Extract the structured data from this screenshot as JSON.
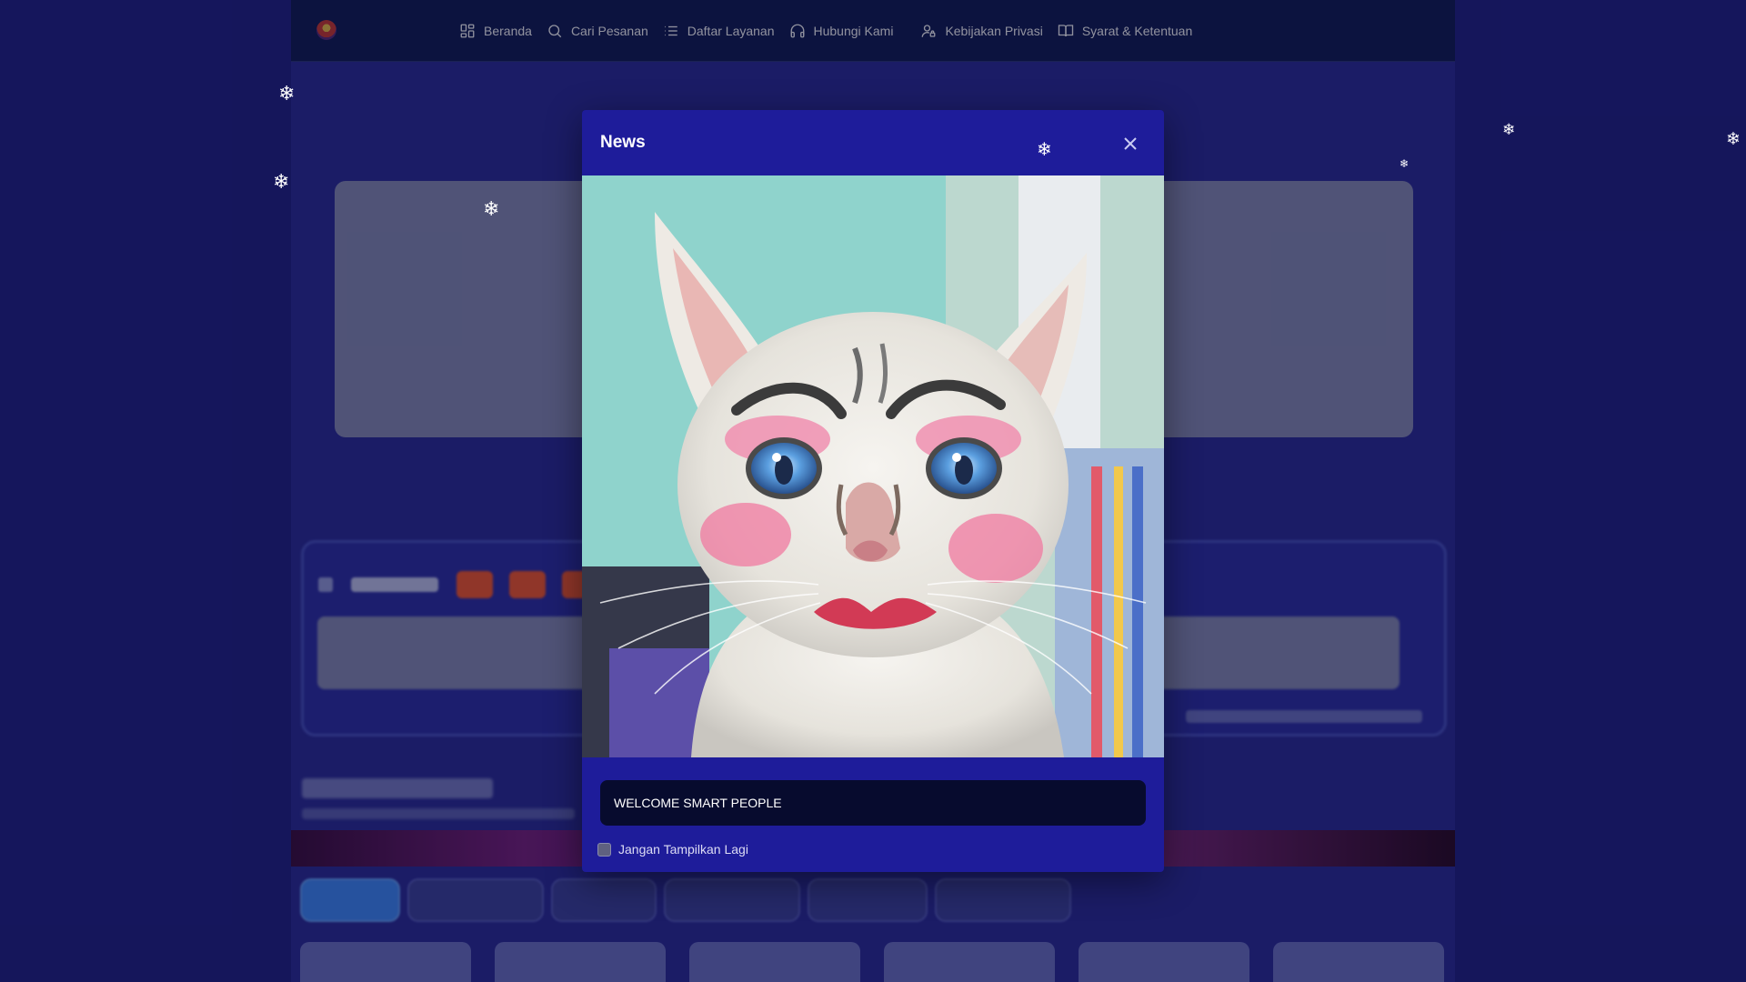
{
  "nav": {
    "items": [
      {
        "label": "Beranda",
        "icon": "grid-icon"
      },
      {
        "label": "Cari Pesanan",
        "icon": "search-icon"
      },
      {
        "label": "Daftar Layanan",
        "icon": "list-icon"
      },
      {
        "label": "Hubungi Kami",
        "icon": "headphones-icon"
      },
      {
        "label": "Kebijakan Privasi",
        "icon": "user-lock-icon"
      },
      {
        "label": "Syarat & Ketentuan",
        "icon": "book-icon"
      }
    ]
  },
  "modal": {
    "title": "News",
    "image_icon": "cat-photo",
    "message": "WELCOME SMART PEOPLE",
    "dont_show_label": "Jangan Tampilkan Lagi",
    "dont_show_checked": false
  },
  "colors": {
    "modal_bg": "#1e1c9a",
    "navbar_bg": "#101a52",
    "message_bg": "#070b2e",
    "page_bg": "#1f1f86"
  }
}
